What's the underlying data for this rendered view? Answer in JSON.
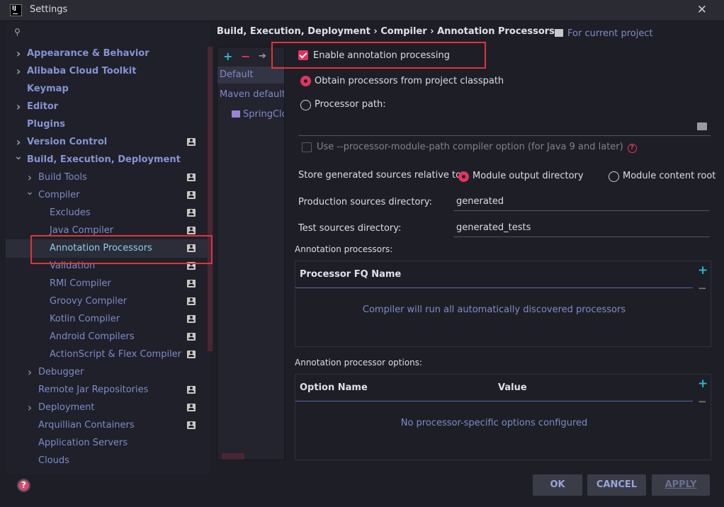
{
  "window": {
    "title": "Settings",
    "icon_text": "IJ"
  },
  "search": {
    "placeholder": "",
    "value": ""
  },
  "tree": [
    {
      "label": "Appearance & Behavior",
      "bold": true,
      "chevron": "right",
      "badge": false
    },
    {
      "label": "Alibaba Cloud Toolkit",
      "bold": true,
      "chevron": "right",
      "badge": false
    },
    {
      "label": "Keymap",
      "bold": true,
      "chevron": "",
      "badge": false
    },
    {
      "label": "Editor",
      "bold": true,
      "chevron": "right",
      "badge": false
    },
    {
      "label": "Plugins",
      "bold": true,
      "chevron": "",
      "badge": false
    },
    {
      "label": "Version Control",
      "bold": true,
      "chevron": "right",
      "badge": true
    },
    {
      "label": "Build, Execution, Deployment",
      "bold": true,
      "chevron": "down",
      "badge": false
    },
    {
      "label": "Build Tools",
      "bold": false,
      "chevron": "right",
      "badge": true
    },
    {
      "label": "Compiler",
      "bold": false,
      "chevron": "down",
      "badge": true
    },
    {
      "label": "Excludes",
      "bold": false,
      "chevron": "",
      "badge": true
    },
    {
      "label": "Java Compiler",
      "bold": false,
      "chevron": "",
      "badge": true
    },
    {
      "label": "Annotation Processors",
      "bold": false,
      "chevron": "",
      "badge": true,
      "selected": true
    },
    {
      "label": "Validation",
      "bold": false,
      "chevron": "",
      "badge": true
    },
    {
      "label": "RMI Compiler",
      "bold": false,
      "chevron": "",
      "badge": true
    },
    {
      "label": "Groovy Compiler",
      "bold": false,
      "chevron": "",
      "badge": true
    },
    {
      "label": "Kotlin Compiler",
      "bold": false,
      "chevron": "",
      "badge": true
    },
    {
      "label": "Android Compilers",
      "bold": false,
      "chevron": "",
      "badge": true
    },
    {
      "label": "ActionScript & Flex Compiler",
      "bold": false,
      "chevron": "",
      "badge": true
    },
    {
      "label": "Debugger",
      "bold": false,
      "chevron": "right",
      "badge": false
    },
    {
      "label": "Remote Jar Repositories",
      "bold": false,
      "chevron": "",
      "badge": true
    },
    {
      "label": "Deployment",
      "bold": false,
      "chevron": "right",
      "badge": true
    },
    {
      "label": "Arquillian Containers",
      "bold": false,
      "chevron": "",
      "badge": true
    },
    {
      "label": "Application Servers",
      "bold": false,
      "chevron": "",
      "badge": false
    },
    {
      "label": "Clouds",
      "bold": false,
      "chevron": "",
      "badge": false
    }
  ],
  "breadcrumb": "Build, Execution, Deployment  ›  Compiler  ›  Annotation Processors",
  "for_project": "For current project",
  "profiles": {
    "toolbar": {
      "add": "+",
      "remove": "−",
      "move": "➔"
    },
    "items": [
      "Default",
      "Maven default a",
      "SpringClo"
    ]
  },
  "options": {
    "enable_label": "Enable annotation processing",
    "enable_checked": true,
    "obtain_label": "Obtain processors from project classpath",
    "processor_path_label": "Processor path:",
    "processor_path_value": "",
    "module_path_label": "Use --processor-module-path compiler option (for Java 9 and later)",
    "module_path_checked": false,
    "store_label": "Store generated sources relative to:",
    "module_output_label": "Module output directory",
    "module_content_label": "Module content root",
    "production_label": "Production sources directory:",
    "production_value": "generated",
    "test_label": "Test sources directory:",
    "test_value": "generated_tests"
  },
  "processors_table": {
    "section_label": "Annotation processors:",
    "column": "Processor FQ Name",
    "empty": "Compiler will run all automatically discovered processors"
  },
  "options_table": {
    "section_label": "Annotation processor options:",
    "col_name": "Option Name",
    "col_value": "Value",
    "empty": "No processor-specific options configured"
  },
  "buttons": {
    "ok": "OK",
    "cancel": "CANCEL",
    "apply": "APPLY"
  },
  "help": "?",
  "colors": {
    "accent": "#e0345e",
    "link": "#7e8bc8",
    "highlight_box": "#e0343c",
    "add_icon": "#2bb6d4"
  }
}
